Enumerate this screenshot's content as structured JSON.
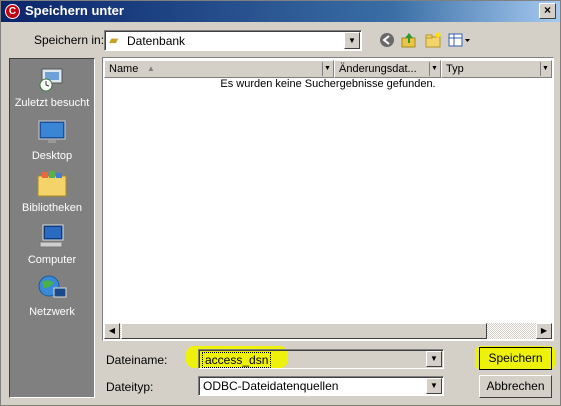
{
  "window": {
    "title": "Speichern unter",
    "close_glyph": "×",
    "icon_letter": "C"
  },
  "location": {
    "label": "Speichern in:",
    "value": "Datenbank"
  },
  "toolbar": {
    "icons": [
      "back-icon",
      "up-folder-icon",
      "new-folder-icon",
      "view-menu-icon"
    ]
  },
  "places": [
    {
      "label": "Zuletzt besucht",
      "icon": "recent-places-icon"
    },
    {
      "label": "Desktop",
      "icon": "desktop-icon"
    },
    {
      "label": "Bibliotheken",
      "icon": "libraries-icon"
    },
    {
      "label": "Computer",
      "icon": "computer-icon"
    },
    {
      "label": "Netzwerk",
      "icon": "network-icon"
    }
  ],
  "file_list": {
    "columns": [
      "Name",
      "Änderungsdat...",
      "Typ"
    ],
    "empty_message": "Es wurden keine Suchergebnisse gefunden."
  },
  "form": {
    "filename_label": "Dateiname:",
    "filename_value": "access_dsn",
    "filetype_label": "Dateityp:",
    "filetype_value": "ODBC-Dateidatenquellen"
  },
  "buttons": {
    "save": "Speichern",
    "cancel": "Abbrechen"
  },
  "colors": {
    "highlight": "#eef20a",
    "title_bar": "#0a246a"
  }
}
